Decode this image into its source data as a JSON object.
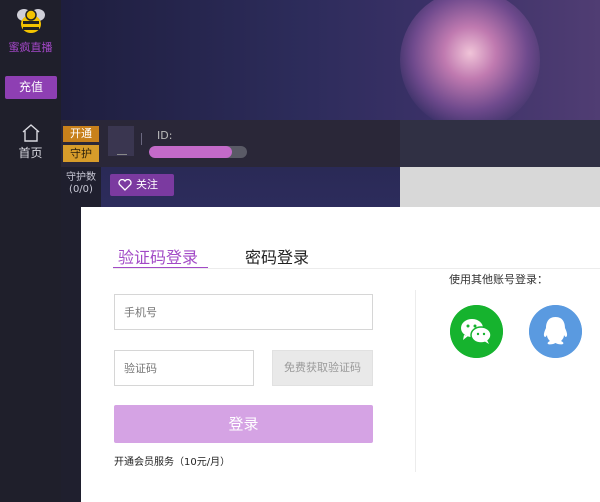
{
  "sidebar": {
    "brand": "蜜疯直播",
    "recharge_label": "充值",
    "home_label": "首页"
  },
  "room": {
    "open_label": "开通",
    "guard_label": "守护",
    "guard_count_label": "守护数",
    "guard_count_value": "(0/0)",
    "id_label": "ID:",
    "follow_label": "关注"
  },
  "login": {
    "tabs": [
      {
        "label": "验证码登录",
        "active": true
      },
      {
        "label": "密码登录",
        "active": false
      }
    ],
    "phone_placeholder": "手机号",
    "code_placeholder": "验证码",
    "get_code_label": "免费获取验证码",
    "submit_label": "登录",
    "membership_text": "开通会员服务（10元/月）",
    "other_accounts_label": "使用其他账号登录：",
    "social": [
      "wechat-icon",
      "qq-icon"
    ]
  },
  "colors": {
    "accent": "#a24ac6",
    "login_button": "#d5a3e4",
    "wechat": "#16b32e",
    "qq": "#5a9ae0"
  }
}
